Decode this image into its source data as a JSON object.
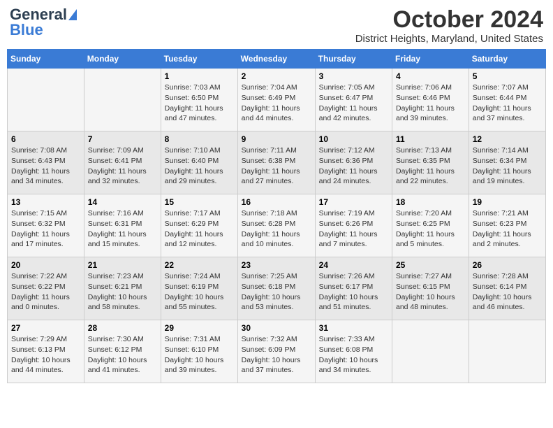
{
  "header": {
    "logo_line1": "General",
    "logo_line2": "Blue",
    "month": "October 2024",
    "location": "District Heights, Maryland, United States"
  },
  "days_of_week": [
    "Sunday",
    "Monday",
    "Tuesday",
    "Wednesday",
    "Thursday",
    "Friday",
    "Saturday"
  ],
  "weeks": [
    [
      {
        "day": "",
        "info": ""
      },
      {
        "day": "",
        "info": ""
      },
      {
        "day": "1",
        "info": "Sunrise: 7:03 AM\nSunset: 6:50 PM\nDaylight: 11 hours and 47 minutes."
      },
      {
        "day": "2",
        "info": "Sunrise: 7:04 AM\nSunset: 6:49 PM\nDaylight: 11 hours and 44 minutes."
      },
      {
        "day": "3",
        "info": "Sunrise: 7:05 AM\nSunset: 6:47 PM\nDaylight: 11 hours and 42 minutes."
      },
      {
        "day": "4",
        "info": "Sunrise: 7:06 AM\nSunset: 6:46 PM\nDaylight: 11 hours and 39 minutes."
      },
      {
        "day": "5",
        "info": "Sunrise: 7:07 AM\nSunset: 6:44 PM\nDaylight: 11 hours and 37 minutes."
      }
    ],
    [
      {
        "day": "6",
        "info": "Sunrise: 7:08 AM\nSunset: 6:43 PM\nDaylight: 11 hours and 34 minutes."
      },
      {
        "day": "7",
        "info": "Sunrise: 7:09 AM\nSunset: 6:41 PM\nDaylight: 11 hours and 32 minutes."
      },
      {
        "day": "8",
        "info": "Sunrise: 7:10 AM\nSunset: 6:40 PM\nDaylight: 11 hours and 29 minutes."
      },
      {
        "day": "9",
        "info": "Sunrise: 7:11 AM\nSunset: 6:38 PM\nDaylight: 11 hours and 27 minutes."
      },
      {
        "day": "10",
        "info": "Sunrise: 7:12 AM\nSunset: 6:36 PM\nDaylight: 11 hours and 24 minutes."
      },
      {
        "day": "11",
        "info": "Sunrise: 7:13 AM\nSunset: 6:35 PM\nDaylight: 11 hours and 22 minutes."
      },
      {
        "day": "12",
        "info": "Sunrise: 7:14 AM\nSunset: 6:34 PM\nDaylight: 11 hours and 19 minutes."
      }
    ],
    [
      {
        "day": "13",
        "info": "Sunrise: 7:15 AM\nSunset: 6:32 PM\nDaylight: 11 hours and 17 minutes."
      },
      {
        "day": "14",
        "info": "Sunrise: 7:16 AM\nSunset: 6:31 PM\nDaylight: 11 hours and 15 minutes."
      },
      {
        "day": "15",
        "info": "Sunrise: 7:17 AM\nSunset: 6:29 PM\nDaylight: 11 hours and 12 minutes."
      },
      {
        "day": "16",
        "info": "Sunrise: 7:18 AM\nSunset: 6:28 PM\nDaylight: 11 hours and 10 minutes."
      },
      {
        "day": "17",
        "info": "Sunrise: 7:19 AM\nSunset: 6:26 PM\nDaylight: 11 hours and 7 minutes."
      },
      {
        "day": "18",
        "info": "Sunrise: 7:20 AM\nSunset: 6:25 PM\nDaylight: 11 hours and 5 minutes."
      },
      {
        "day": "19",
        "info": "Sunrise: 7:21 AM\nSunset: 6:23 PM\nDaylight: 11 hours and 2 minutes."
      }
    ],
    [
      {
        "day": "20",
        "info": "Sunrise: 7:22 AM\nSunset: 6:22 PM\nDaylight: 11 hours and 0 minutes."
      },
      {
        "day": "21",
        "info": "Sunrise: 7:23 AM\nSunset: 6:21 PM\nDaylight: 10 hours and 58 minutes."
      },
      {
        "day": "22",
        "info": "Sunrise: 7:24 AM\nSunset: 6:19 PM\nDaylight: 10 hours and 55 minutes."
      },
      {
        "day": "23",
        "info": "Sunrise: 7:25 AM\nSunset: 6:18 PM\nDaylight: 10 hours and 53 minutes."
      },
      {
        "day": "24",
        "info": "Sunrise: 7:26 AM\nSunset: 6:17 PM\nDaylight: 10 hours and 51 minutes."
      },
      {
        "day": "25",
        "info": "Sunrise: 7:27 AM\nSunset: 6:15 PM\nDaylight: 10 hours and 48 minutes."
      },
      {
        "day": "26",
        "info": "Sunrise: 7:28 AM\nSunset: 6:14 PM\nDaylight: 10 hours and 46 minutes."
      }
    ],
    [
      {
        "day": "27",
        "info": "Sunrise: 7:29 AM\nSunset: 6:13 PM\nDaylight: 10 hours and 44 minutes."
      },
      {
        "day": "28",
        "info": "Sunrise: 7:30 AM\nSunset: 6:12 PM\nDaylight: 10 hours and 41 minutes."
      },
      {
        "day": "29",
        "info": "Sunrise: 7:31 AM\nSunset: 6:10 PM\nDaylight: 10 hours and 39 minutes."
      },
      {
        "day": "30",
        "info": "Sunrise: 7:32 AM\nSunset: 6:09 PM\nDaylight: 10 hours and 37 minutes."
      },
      {
        "day": "31",
        "info": "Sunrise: 7:33 AM\nSunset: 6:08 PM\nDaylight: 10 hours and 34 minutes."
      },
      {
        "day": "",
        "info": ""
      },
      {
        "day": "",
        "info": ""
      }
    ]
  ]
}
